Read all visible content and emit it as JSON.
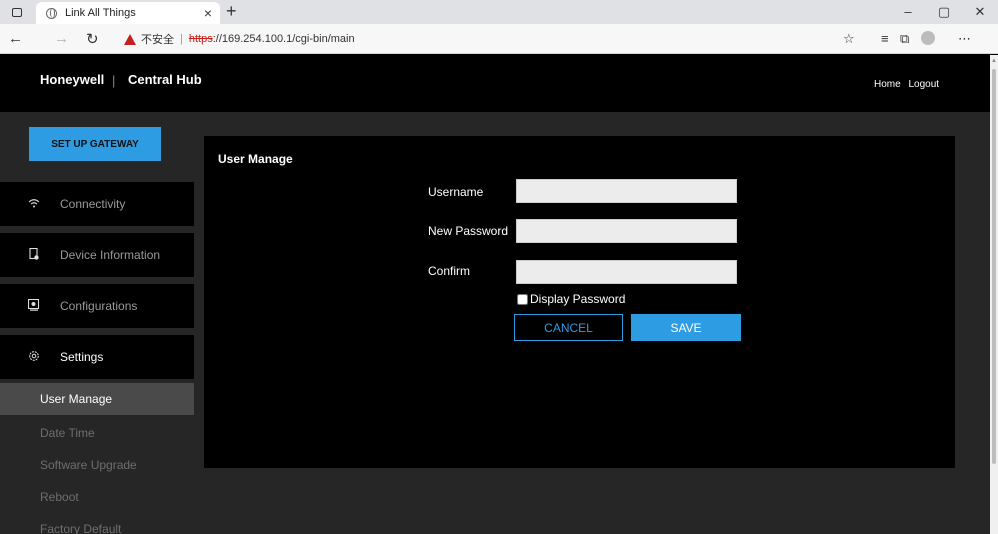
{
  "browser": {
    "tab_title": "Link All Things",
    "tab_close": "×",
    "new_tab": "+",
    "window_buttons": [
      "–",
      "▢",
      "✕"
    ],
    "address": {
      "security_label": "不安全",
      "separator": "|",
      "protocol": "https",
      "url_rest": "://169.254.100.1/cgi-bin/main"
    },
    "icons": [
      "back-icon",
      "forward-icon",
      "refresh-icon",
      "warning-icon",
      "favorite-add-icon",
      "favorites-icon",
      "collections-icon",
      "profile-icon",
      "more-icon"
    ]
  },
  "header": {
    "brand": "Honeywell",
    "divider": "|",
    "product": "Central Hub",
    "links": [
      "Home",
      "Logout"
    ]
  },
  "sidebar": {
    "setup_button": "SET UP GATEWAY",
    "items": [
      {
        "label": "Connectivity",
        "icon": "wifi-icon"
      },
      {
        "label": "Device Information",
        "icon": "device-icon"
      },
      {
        "label": "Configurations",
        "icon": "config-icon"
      },
      {
        "label": "Settings",
        "icon": "settings-icon"
      }
    ],
    "sub_items": [
      "User Manage",
      "Date Time",
      "Software Upgrade",
      "Reboot",
      "Factory Default"
    ]
  },
  "form": {
    "title": "User Manage",
    "username_label": "Username",
    "new_password_label": "New Password",
    "confirm_label": "Confirm",
    "username_value": "",
    "new_password_value": "",
    "confirm_value": "",
    "display_password_label": "Display Password",
    "cancel_label": "CANCEL",
    "save_label": "SAVE"
  },
  "colors": {
    "accent": "#2e9ce3",
    "page_bg": "#262626",
    "panel_bg": "#000000",
    "warning": "#c5221f"
  }
}
